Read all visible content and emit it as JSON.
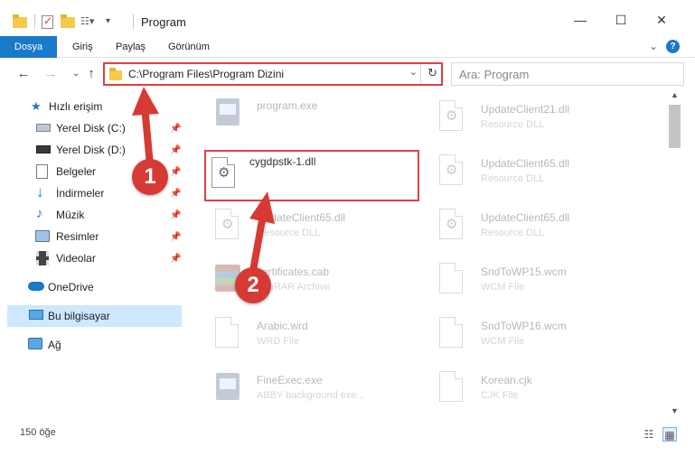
{
  "window": {
    "title": "Program"
  },
  "ribbon": {
    "tabs": [
      "Dosya",
      "Giriş",
      "Paylaş",
      "Görünüm"
    ]
  },
  "navigation": {
    "address": "C:\\Program Files\\Program Dizini",
    "search_placeholder": "Ara: Program"
  },
  "sidebar": {
    "items": [
      {
        "label": "Hızlı erişim",
        "icon": "star-icon"
      },
      {
        "label": "Yerel Disk (C:)",
        "icon": "drive-icon",
        "pinned": true
      },
      {
        "label": "Yerel Disk (D:)",
        "icon": "drive-icon",
        "pinned": true
      },
      {
        "label": "Belgeler",
        "icon": "documents-icon",
        "pinned": true
      },
      {
        "label": "İndirmeler",
        "icon": "download-arrow-icon",
        "pinned": true
      },
      {
        "label": "Müzik",
        "icon": "music-note-icon",
        "pinned": true
      },
      {
        "label": "Resimler",
        "icon": "pictures-icon",
        "pinned": true
      },
      {
        "label": "Videolar",
        "icon": "film-icon",
        "pinned": true
      },
      {
        "label": "OneDrive",
        "icon": "cloud-icon"
      },
      {
        "label": "Bu bilgisayar",
        "icon": "computer-icon",
        "selected": true
      },
      {
        "label": "Ağ",
        "icon": "network-icon"
      }
    ]
  },
  "files": {
    "left": [
      {
        "name": "program.exe",
        "type": ""
      },
      {
        "name": "cygdpstk-1.dll",
        "type": ""
      },
      {
        "name": "UpdateClient65.dll",
        "type": "Resource DLL"
      },
      {
        "name": "certificates.cab",
        "type": "WinRAR Archive"
      },
      {
        "name": "Arabic.wrd",
        "type": "WRD File"
      },
      {
        "name": "FineExec.exe",
        "type": "ABBY background exe..."
      }
    ],
    "right": [
      {
        "name": "UpdateClient21.dll",
        "type": "Resource DLL"
      },
      {
        "name": "UpdateClient65.dll",
        "type": "Resource DLL"
      },
      {
        "name": "UpdateClient65.dll",
        "type": "Resource DLL"
      },
      {
        "name": "SndToWP15.wcm",
        "type": "WCM File"
      },
      {
        "name": "SndToWP16.wcm",
        "type": "WCM File"
      },
      {
        "name": "Korean.cjk",
        "type": "CJK File"
      }
    ]
  },
  "status": {
    "item_count": "150 öğe"
  },
  "annotations": {
    "step1": "1",
    "step2": "2"
  },
  "colors": {
    "accent": "#1979ca",
    "highlight": "#e04040",
    "badge": "#d73a35"
  }
}
